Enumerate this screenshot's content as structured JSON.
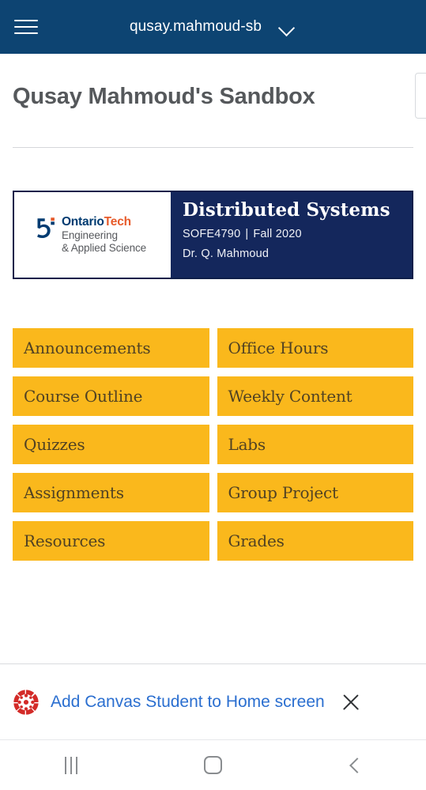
{
  "appbar": {
    "menu_icon": "hamburger-menu-icon",
    "title": "qusay.mahmoud-sb",
    "chevron_icon": "chevron-down-icon",
    "background_color": "#0d4472"
  },
  "page": {
    "title": "Qusay Mahmoud's Sandbox",
    "title_color": "#55585b"
  },
  "banner": {
    "background_color": "#14275c",
    "logo": {
      "mark_icon": "ontario-tech-logo-mark",
      "name_primary": "Ontario",
      "name_accent": "Tech",
      "accent_color": "#e75b2b",
      "primary_color": "#003b71",
      "faculty_line1": "Engineering",
      "faculty_line2": "& Applied Science"
    },
    "course_name": "Distributed Systems",
    "course_code": "SOFE4790",
    "separator": "|",
    "term": "Fall 2020",
    "instructor": "Dr. Q. Mahmoud"
  },
  "tiles": {
    "background_color": "#fab81c",
    "text_color": "#514223",
    "items": [
      {
        "label": "Announcements"
      },
      {
        "label": "Office Hours"
      },
      {
        "label": "Course Outline"
      },
      {
        "label": "Weekly Content"
      },
      {
        "label": "Quizzes"
      },
      {
        "label": "Labs"
      },
      {
        "label": "Assignments"
      },
      {
        "label": "Group Project"
      },
      {
        "label": "Resources"
      },
      {
        "label": "Grades"
      }
    ]
  },
  "promo": {
    "app_icon": "canvas-logo-icon",
    "message": "Add Canvas Student to Home screen",
    "link_color": "#2b6fd0",
    "close_icon": "close-icon"
  },
  "navbar": {
    "recents_icon": "recents-icon",
    "home_icon": "home-icon",
    "back_icon": "back-icon"
  }
}
